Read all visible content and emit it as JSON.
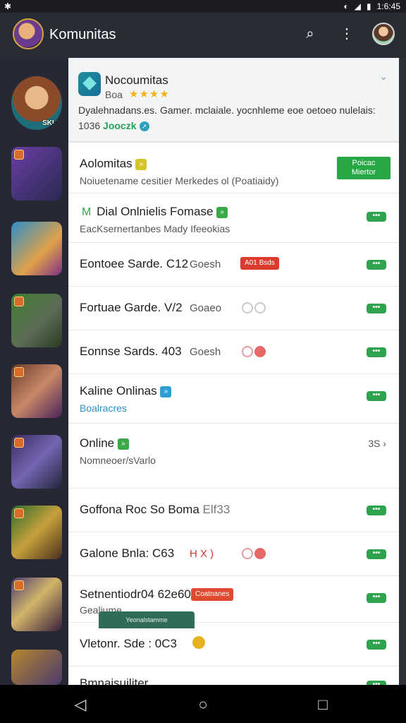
{
  "status": {
    "left_icon": "notification-icon",
    "time": "1:6:45"
  },
  "appbar": {
    "title": "Komunitas"
  },
  "header": {
    "name": "Nocoumitas",
    "sub": "Boa",
    "stars": "★★★★",
    "desc": "Dyalehnadans.es. Gamer. mclaiale. yocnhleme eoe oetoeo nulelais:",
    "link_prefix": "1036",
    "link_green": "Jooczk"
  },
  "rows": [
    {
      "label": "Aolomitas",
      "chip": "»",
      "meta": "Noiuetename cesitier Merkedes ol (Poatiaidy)",
      "button": "Poicac\nMiertor"
    },
    {
      "label": "Dial Onlnielis Fomase",
      "chip": "»",
      "meta": "EacKsernertanbes Mady Ifeeokias"
    },
    {
      "label": "Eontoee Sarde. C12",
      "code": "Goesh",
      "tag": "A01 Bsds"
    },
    {
      "label": "Fortuae Garde. V/2",
      "code": "Goaeo"
    },
    {
      "label": "Eonnse Sards. 403",
      "code": "Goesh"
    },
    {
      "label": "Kaline Onlinas",
      "chip": "»",
      "meta": "Boalracres"
    },
    {
      "label": "Online",
      "chip": "»",
      "meta": "Nomneoer/sVarlo",
      "right": "3S"
    },
    {
      "label": "Goffona Roc So Boma",
      "code": "Elf33"
    },
    {
      "label": "Galone Bnla: C63",
      "code": "H X )"
    },
    {
      "label": "Setnentiodr04 62e60",
      "tag": "Coatnanes",
      "meta": "Gealiume"
    },
    {
      "label": "Vletonr. Sde : 0C3"
    },
    {
      "label": "Bmnaisuiliter"
    }
  ],
  "more_label": "•••",
  "toast": "Yeonalstamme",
  "colors": {
    "accent_green": "#2ea44f",
    "panel": "#ffffff",
    "rail": "#262833"
  }
}
